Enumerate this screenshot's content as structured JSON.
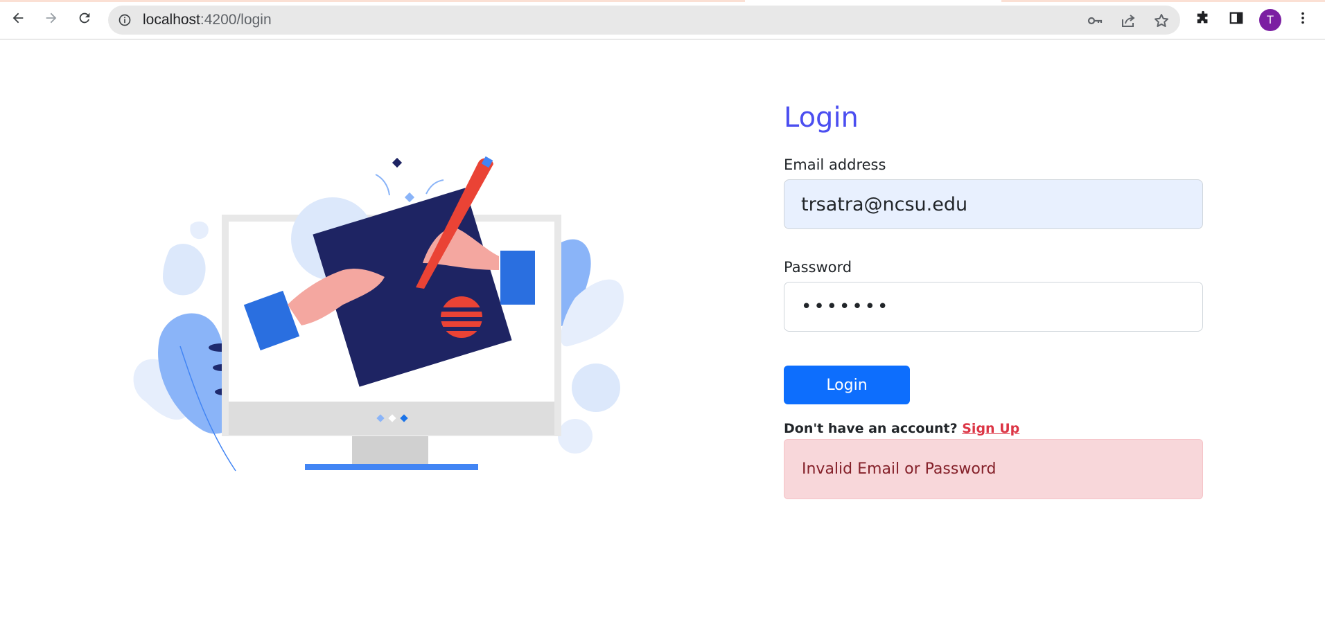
{
  "browser": {
    "url_host": "localhost",
    "url_path": ":4200/login",
    "profile_initial": "T",
    "icons": [
      "back-arrow-icon",
      "forward-arrow-icon",
      "reload-icon",
      "site-info-icon",
      "key-icon",
      "share-icon",
      "bookmark-star-icon",
      "extensions-puzzle-icon",
      "side-panel-icon",
      "kebab-menu-icon"
    ],
    "colors": {
      "avatar": "#7b1fa2",
      "omnibox": "#e8e8e8"
    }
  },
  "login": {
    "title": "Login",
    "email_label": "Email address",
    "email_value": "trsatra@ncsu.edu",
    "password_label": "Password",
    "password_value": "•••••••",
    "submit_label": "Login",
    "no_account_text": "Don't have an account?",
    "signup_link": "Sign Up",
    "error_message": "Invalid Email or Password",
    "colors": {
      "title": "#4b4ef0",
      "button": "#0d6efd",
      "link": "#dc3545",
      "alert_bg": "#f8d7da",
      "alert_text": "#842029",
      "email_bg": "#e8f0fe"
    }
  }
}
